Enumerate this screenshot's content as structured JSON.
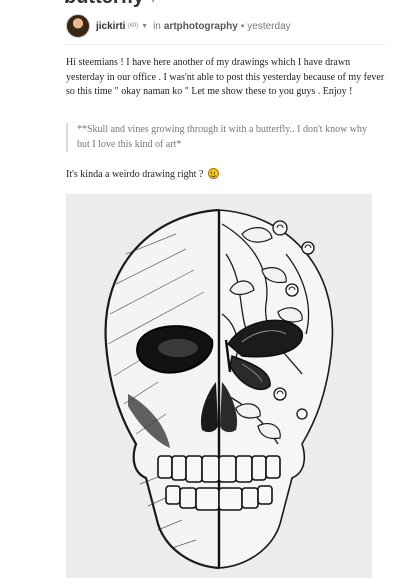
{
  "post": {
    "title": "butterfly",
    "title_icon": "butterfly-icon",
    "author": {
      "name": "jickirti",
      "reputation": "(40)",
      "avatar_icon": "user-avatar-icon"
    },
    "meta": {
      "in_label": "in",
      "community": "artphotography",
      "separator": "•",
      "time": "yesterday"
    },
    "body": {
      "intro": "Hi steemians ! I have here another of my drawings which I have drawn yesterday in our office . I was'nt able to post this yesterday because of my fever so this time \" okay naman ko \" Let me show these to you guys . Enjoy !",
      "quote": "**Skull and vines growing through it with a butterfly.. I don't know why but I love this kind of art*",
      "caption": "It's kinda a weirdo drawing right ?",
      "caption_icon": "smiley-emoji-icon"
    },
    "image": {
      "icon": "skull-butterfly-drawing-image"
    }
  }
}
